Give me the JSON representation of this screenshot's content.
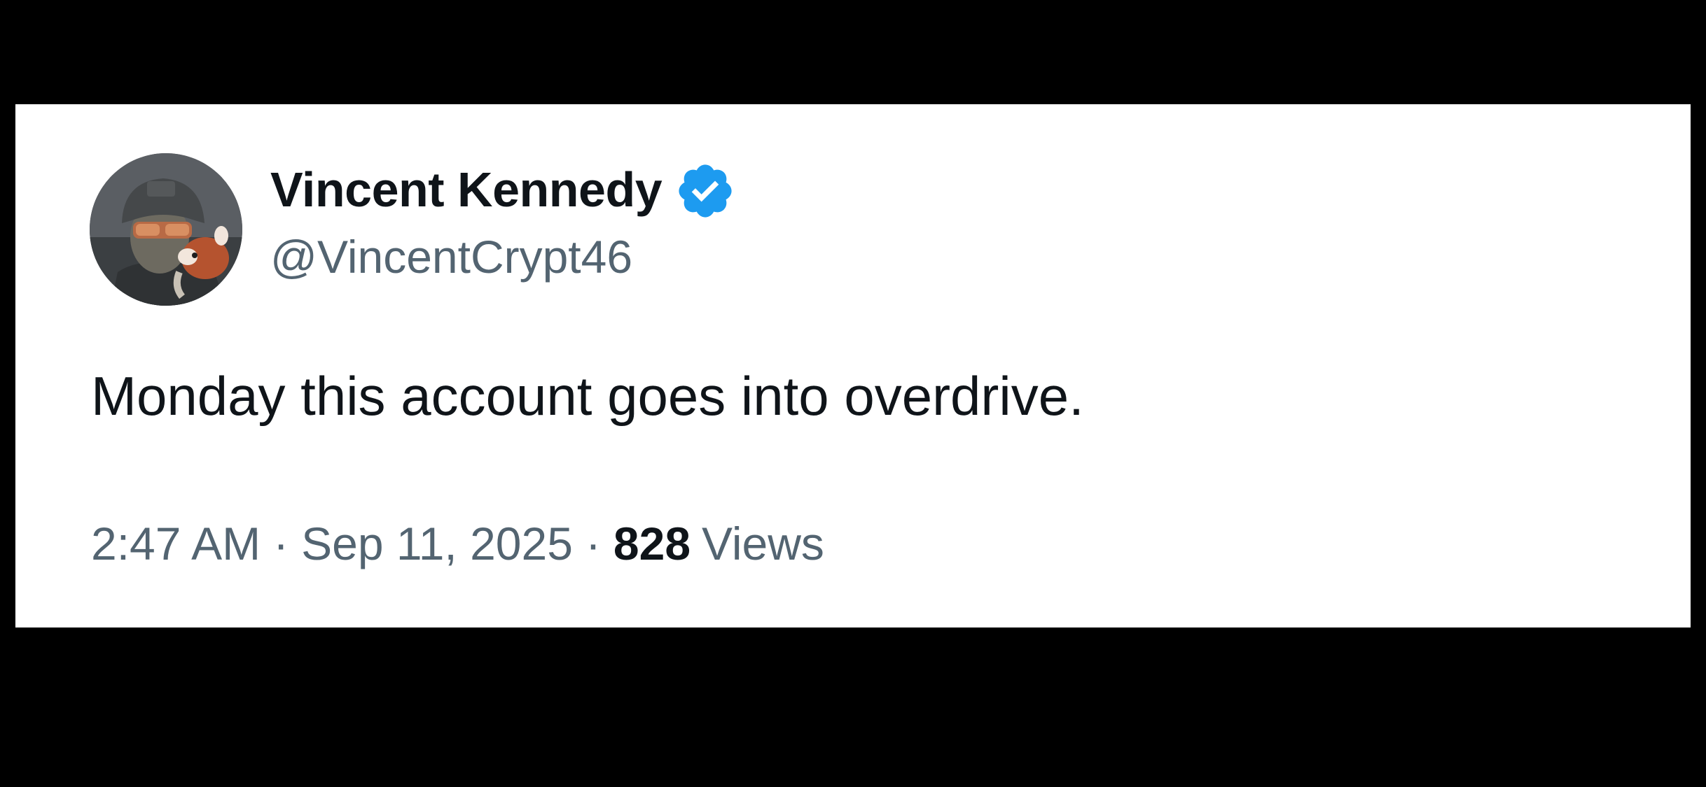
{
  "tweet": {
    "author": {
      "display_name": "Vincent Kennedy",
      "handle": "@VincentCrypt46",
      "verified": true,
      "avatar_icon": "avatar-soldier-with-red-panda"
    },
    "text": "Monday this account goes into overdrive.",
    "time": "2:47 AM",
    "separator": "·",
    "date": "Sep 11, 2025",
    "views_count": "828",
    "views_label": "Views"
  },
  "colors": {
    "background": "#000000",
    "card": "#ffffff",
    "primary_text": "#0f1419",
    "secondary_text": "#536471",
    "verified_blue": "#1d9bf0"
  }
}
